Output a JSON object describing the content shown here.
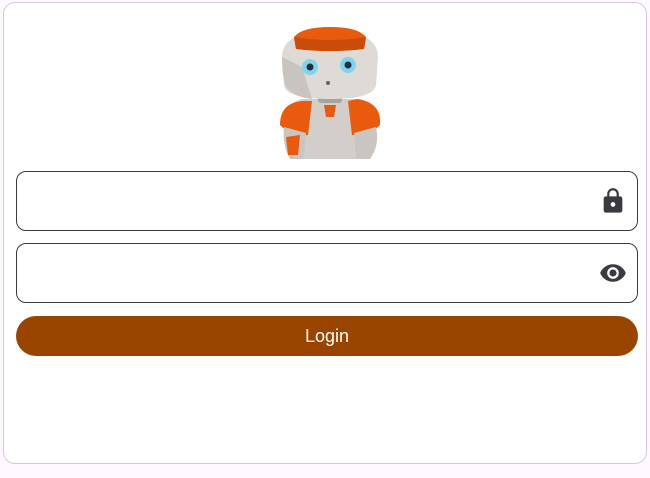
{
  "logo": {
    "name": "robot-logo"
  },
  "form": {
    "username": {
      "value": "",
      "placeholder": "",
      "icon": "lock-icon"
    },
    "password": {
      "value": "",
      "placeholder": "",
      "icon": "eye-icon"
    },
    "login_label": "Login"
  },
  "colors": {
    "accent": "#994500",
    "robot_orange": "#ea5a0c",
    "outline": "#3c3a40",
    "icon": "#3a3a40"
  }
}
